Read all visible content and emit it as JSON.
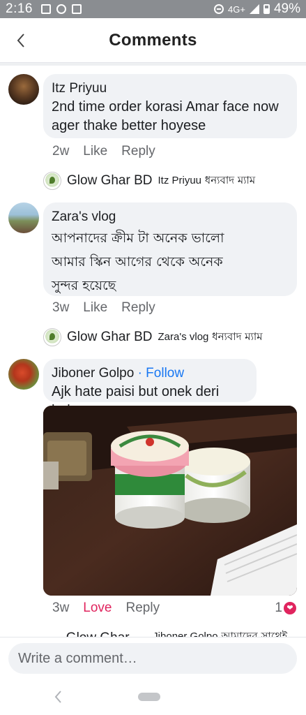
{
  "status_bar": {
    "time": "2:16",
    "network": "4G+",
    "battery": "49%"
  },
  "header": {
    "title": "Comments"
  },
  "comments": [
    {
      "name": "Itz Priyuu",
      "text": "2nd time order korasi Amar face now ager thake better hoyese",
      "time": "2w",
      "like": "Like",
      "reply": "Reply",
      "page_reply": {
        "name": "Glow Ghar BD",
        "mention": "Itz Priyuu",
        "text": "ধন্যবাদ ম্যাম"
      }
    },
    {
      "name": "Zara's vlog",
      "text_lines": [
        "আপনাদের ক্রীম টা অনেক ভালো",
        "আমার স্কিন আগের থেকে অনেক",
        "সুন্দর হয়েছে"
      ],
      "time": "3w",
      "like": "Like",
      "reply": "Reply",
      "page_reply": {
        "name": "Glow Ghar BD",
        "mention": "Zara's vlog",
        "text": "ধন্যবাদ ম্যাম"
      }
    },
    {
      "name": "Jiboner Golpo",
      "follow": "· Follow",
      "text": "Ajk hate paisi but onek deri holo",
      "time": "3w",
      "reaction_label": "Love",
      "reply": "Reply",
      "reaction_count": "1",
      "page_reply": {
        "name": "Glow Ghar BD",
        "mention": "Jiboner Golpo",
        "text": "আমাদের সাথেই থাকুন"
      }
    }
  ],
  "composer": {
    "placeholder": "Write a comment…"
  },
  "colors": {
    "accent": "#1877f2",
    "love": "#e0245e",
    "bubble": "#f0f2f5"
  }
}
